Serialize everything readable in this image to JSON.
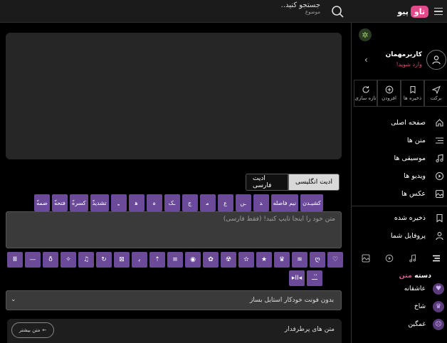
{
  "header": {
    "logo_badge": "تاو",
    "logo_text": "پیو",
    "search_text": "جستجو کنید..",
    "search_sub": "موضوع"
  },
  "tabs": {
    "english_label": "ادیت انگلیسی",
    "farsi_label": "ادیت فارسی"
  },
  "row1_buttons": [
    "ّضمه",
    "ّفتحه",
    "ّکسره",
    "ّتشدید",
    "ـِ",
    "ﻫ",
    "ہ",
    "ـک",
    "ج",
    "ﻣ",
    "ع",
    "ـں",
    "ﺪ",
    "نیم فاصله",
    "کشیـدن"
  ],
  "textbox": {
    "placeholder": "متن خود را اینجا تایپ کنید! (فقط فارسی)"
  },
  "row2_buttons": [
    "Ⅲ",
    "—",
    "ð",
    "✧",
    "♫",
    "↻",
    "⊠",
    "ﺑ",
    "⇡",
    "≡",
    "◉",
    "✿",
    "☢",
    "✫",
    "★",
    "♛",
    "≋",
    "ღ",
    "♡"
  ],
  "row3_buttons": [
    "▸II◂",
    "ـٰـٰـ"
  ],
  "font_select": {
    "value": "بدون فونت خودکار استایل بساز"
  },
  "popular": {
    "title": "متن های پرطرفدار",
    "more_label": "متن بیشتر"
  },
  "sidebar": {
    "user_name": "کاربرمهمان",
    "user_login": "وارد شوید!",
    "actions": [
      {
        "label": "برکت",
        "icon": "send-icon"
      },
      {
        "label": "ذخیره ها",
        "icon": "bookmark-icon"
      },
      {
        "label": "افزودن",
        "icon": "plus-circle-icon"
      },
      {
        "label": "تازه سازی",
        "icon": "refresh-icon"
      }
    ],
    "menu": [
      {
        "label": "صفحه اصلی",
        "icon": "home-icon"
      },
      {
        "label": "متن ها",
        "icon": "text-lines-icon"
      },
      {
        "label": "موسیقی ها",
        "icon": "music-icon"
      },
      {
        "label": "ویدیو ها",
        "icon": "video-icon"
      },
      {
        "label": "عکس ها",
        "icon": "image-icon"
      },
      {
        "label": "ذخیره شده",
        "icon": "bookmark-icon"
      },
      {
        "label": "پروفایل شما",
        "icon": "user-icon"
      }
    ],
    "categories_title_a": "دسته",
    "categories_title_b": "متن",
    "categories": [
      {
        "label": "عاشقانه",
        "icon": "heart-icon"
      },
      {
        "label": "شاخ",
        "icon": "crown-icon"
      },
      {
        "label": "غمگین",
        "icon": "sad-face-icon"
      }
    ]
  },
  "colors": {
    "accent": "#6b4a9a",
    "brand_pink": "#e04b8a"
  }
}
